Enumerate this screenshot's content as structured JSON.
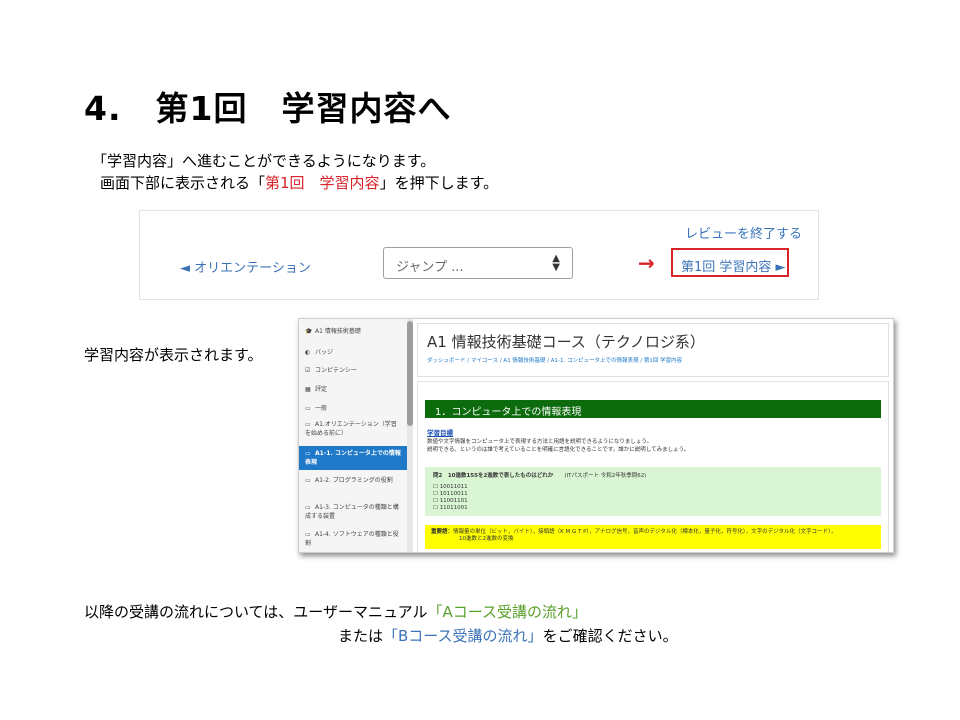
{
  "title": "4.　第1回　学習内容へ",
  "intro": {
    "line1": "「学習内容」へ進むことができるようになります。",
    "line2_pre": "画面下部に表示される「",
    "line2_highlight": "第1回　学習内容",
    "line2_post": "」を押下します。"
  },
  "nav": {
    "review_end": "レビューを終了する",
    "prev": "◄ オリエンテーション",
    "jump_value": "ジャンプ ...",
    "arrow": "→",
    "next": "第1回 学習内容 ►"
  },
  "shown_text": "学習内容が表示されます。",
  "lms": {
    "sidebar": [
      {
        "icon": "🎓",
        "label": "A1 情報技術基礎"
      },
      {
        "icon": "◐",
        "label": "バッジ"
      },
      {
        "icon": "☑",
        "label": "コンピテンシー"
      },
      {
        "icon": "▦",
        "label": "評定"
      },
      {
        "icon": "▭",
        "label": "一般"
      },
      {
        "icon": "▭",
        "label": "A1.オリエンテーション（学習を始める前に）"
      },
      {
        "icon": "▭",
        "label": "A1-1. コンピュータ上での情報表現",
        "active": true
      },
      {
        "icon": "▭",
        "label": "A1-2. プログラミングの役割"
      },
      {
        "icon": "▭",
        "label": "A1-3. コンピュータの種類と構成する装置"
      },
      {
        "icon": "▭",
        "label": "A1-4. ソフトウェアの種類と役割"
      }
    ],
    "course_title": "A1 情報技術基礎コース（テクノロジ系）",
    "breadcrumb": "ダッシュボード / マイコース / A1 情報技術基礎 / A1-1. コンピュータ上での情報表現 / 第1回 学習内容",
    "section_title": "1．コンピュータ上での情報表現",
    "goal_label": "学習目標",
    "goal_line1": "数値や文字情報をコンピュータ上で表現する方法と用語を説明できるようになりましょう。",
    "goal_line2": "説明できる、というのは誰で考えていることを明確に言語化できることです。誰かに説明してみましょう。",
    "question_title": "問2　10進数155を2進数で表したものはどれか",
    "question_source": "(ITパスポート 令和2年秋季問62)",
    "options": [
      "10011011",
      "10110011",
      "11001101",
      "11011001"
    ],
    "key_label": "重要語：",
    "key_line1": "情報量の単位（ビット，バイト），接頭語（K M G T P），アナログ信号，音声のデジタル化（標本化，量子化，符号化），文字のデジタル化（文字コード），",
    "key_line2": "10進数と2進数の変換"
  },
  "outro": {
    "l1_pre": "以降の受講の流れについては、ユーザーマニュアル",
    "l1_link": "「Aコース受講の流れ」",
    "l2_pre": "または",
    "l2_link": "「Bコース受講の流れ」",
    "l2_post": "をご確認ください。"
  },
  "colors": {
    "highlight_red": "#d9232a",
    "link_green": "#5aa02c",
    "link_blue": "#3b73b9",
    "section_green": "#0c6b0c",
    "active_blue": "#1f78c8"
  }
}
